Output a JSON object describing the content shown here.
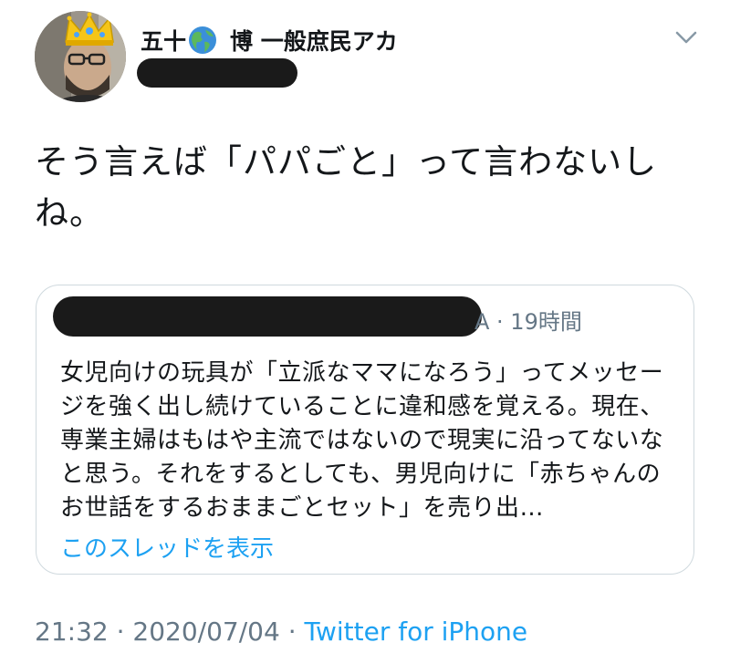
{
  "author": {
    "name_part1": "五十",
    "globe_icon": "earth-globe-americas",
    "name_part2": "博 一般庶民アカ",
    "handle": ""
  },
  "tweet": {
    "text": "そう言えば「パパごと」って言わないしね。"
  },
  "quoted": {
    "meta": "A · 19時間",
    "text": "女児向けの玩具が「立派なママになろう」ってメッセージを強く出し続けていることに違和感を覚える。現在、専業主婦はもはや主流ではないので現実に沿ってないなと思う。それをするとしても、男児向けに「赤ちゃんのお世話をするおままごとセット」を売り出…",
    "show_thread": "このスレッドを表示"
  },
  "footer": {
    "time": "21:32",
    "separator1": " · ",
    "date": "2020/07/04",
    "separator2": " · ",
    "source": "Twitter for iPhone"
  },
  "colors": {
    "text": "#14171a",
    "secondary": "#657786",
    "link": "#1da1f2",
    "border": "#cfd9de",
    "redaction": "#1a1a1a"
  },
  "icons": [
    "crown-icon",
    "earth-globe-icon",
    "chevron-down-icon"
  ]
}
